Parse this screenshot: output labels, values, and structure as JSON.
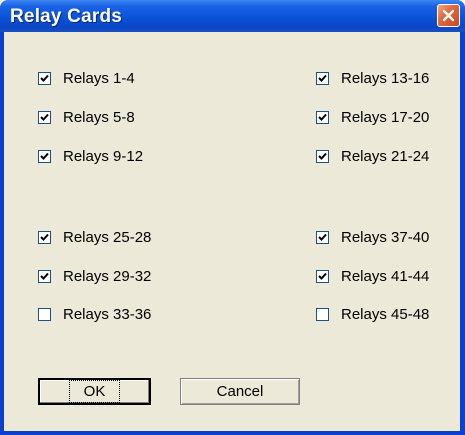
{
  "window": {
    "title": "Relay Cards"
  },
  "checkboxes": [
    {
      "label": "Relays 1-4",
      "checked": true
    },
    {
      "label": "Relays 5-8",
      "checked": true
    },
    {
      "label": "Relays 9-12",
      "checked": true
    },
    {
      "label": "Relays 25-28",
      "checked": true
    },
    {
      "label": "Relays 29-32",
      "checked": true
    },
    {
      "label": "Relays 33-36",
      "checked": false
    },
    {
      "label": "Relays 13-16",
      "checked": true
    },
    {
      "label": "Relays 17-20",
      "checked": true
    },
    {
      "label": "Relays 21-24",
      "checked": true
    },
    {
      "label": "Relays 37-40",
      "checked": true
    },
    {
      "label": "Relays 41-44",
      "checked": true
    },
    {
      "label": "Relays 45-48",
      "checked": false
    }
  ],
  "buttons": {
    "ok": "OK",
    "cancel": "Cancel"
  }
}
